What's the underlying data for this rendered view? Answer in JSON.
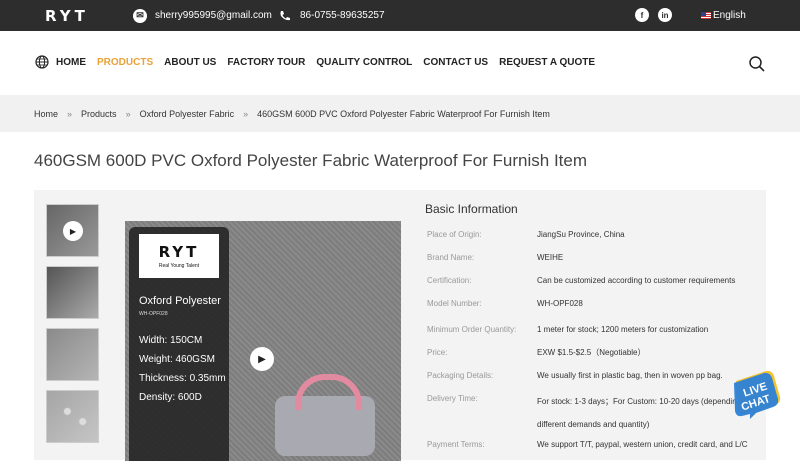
{
  "topbar": {
    "logo": "RYT",
    "email": "sherry995995@gmail.com",
    "phone": "86-0755-89635257",
    "language": "English"
  },
  "nav": {
    "items": [
      "HOME",
      "PRODUCTS",
      "ABOUT US",
      "FACTORY TOUR",
      "QUALITY CONTROL",
      "CONTACT US",
      "REQUEST A QUOTE"
    ],
    "active_index": 1
  },
  "breadcrumb": [
    "Home",
    "Products",
    "Oxford Polyester Fabric",
    "460GSM 600D PVC Oxford Polyester Fabric Waterproof For Furnish Item"
  ],
  "page_title": "460GSM 600D PVC Oxford Polyester Fabric Waterproof For Furnish Item",
  "main_image": {
    "brand": "RYT",
    "tagline": "Real Young Talent",
    "product_name": "Oxford Polyester",
    "model": "WH-OPF028",
    "specs": [
      "Width: 150CM",
      "Weight: 460GSM",
      "Thickness: 0.35mm",
      "Density: 600D"
    ]
  },
  "info": {
    "heading": "Basic Information",
    "rows": [
      {
        "k": "Place of Origin:",
        "v": "JiangSu Province, China"
      },
      {
        "k": "Brand Name:",
        "v": "WEIHE"
      },
      {
        "k": "Certification:",
        "v": "Can be customized according to customer requirements"
      },
      {
        "k": "Model Number:",
        "v": "WH-OPF028"
      },
      {
        "k": "Minimum Order Quantity:",
        "v": "1 meter for stock; 1200 meters for customization"
      },
      {
        "k": "Price:",
        "v": "EXW $1.5-$2.5（Negotiable）"
      },
      {
        "k": "Packaging Details:",
        "v": "We usually first in plastic bag, then in woven pp bag."
      },
      {
        "k": "Delivery Time:",
        "v": "For stock: 1-3 days；For Custom: 10-20 days (depending on different demands and quantity)"
      },
      {
        "k": "Payment Terms:",
        "v": "We support T/T, paypal, western union, credit card, and L/C"
      }
    ]
  },
  "livechat": "LIVE CHAT",
  "colors": {
    "topbar": "#2d2d2d",
    "accent": "#e8a23a",
    "breadcrumb_bg": "#f1f1f1"
  }
}
